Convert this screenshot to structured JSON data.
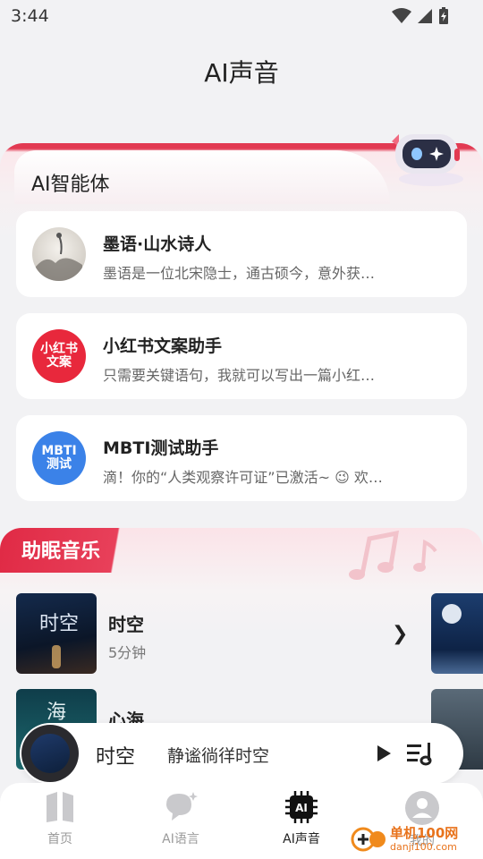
{
  "status_bar": {
    "time": "3:44"
  },
  "page": {
    "title": "AI声音"
  },
  "ai_agents": {
    "section_title": "AI智能体",
    "items": [
      {
        "name": "墨语·山水诗人",
        "desc": "墨语是一位北宋隐士，通古硕今，意外获…",
        "avatar_text": ""
      },
      {
        "name": "小红书文案助手",
        "desc": "只需要关键语句，我就可以写出一篇小红…",
        "avatar_text": "小红书\n文案"
      },
      {
        "name": "MBTI测试助手",
        "desc": "滴！你的“人类观察许可证”已激活~ 😉 欢…",
        "avatar_text": "MBTI\n测试"
      }
    ]
  },
  "sleep_music": {
    "section_title": "助眠音乐",
    "tracks": [
      {
        "name": "时空",
        "duration": "5分钟",
        "cover_text": "时空"
      },
      {
        "name": "心海",
        "duration": "",
        "cover_text": "海"
      }
    ]
  },
  "player": {
    "track": "时空",
    "subtitle": "静谧徜徉时空"
  },
  "tabbar": {
    "items": [
      {
        "label": "首页"
      },
      {
        "label": "AI语言"
      },
      {
        "label": "AI声音"
      },
      {
        "label": "我的"
      }
    ]
  },
  "watermark": {
    "text1": "单机100网",
    "text2": "danji100.com"
  },
  "colors": {
    "accent": "#e02a45",
    "agent_blue": "#3b82e8",
    "agent_red": "#e8283c"
  }
}
